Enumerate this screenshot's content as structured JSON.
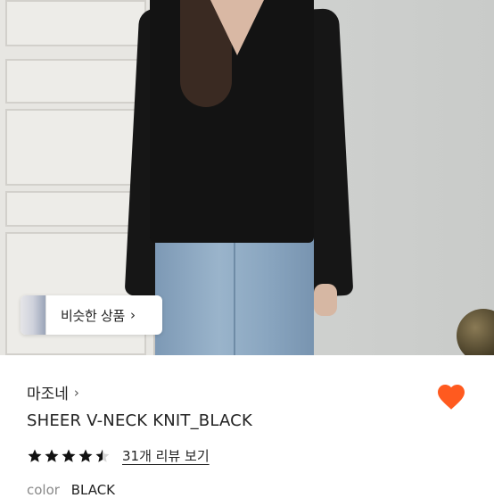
{
  "hero": {
    "similar_products_label": "비슷한 상품",
    "similar_products_arrow": "›"
  },
  "product": {
    "brand": "마조네",
    "brand_arrow": "›",
    "title": "SHEER V-NECK KNIT_BLACK",
    "rating": 4.5,
    "review_link": "31개 리뷰 보기",
    "option_label": "color",
    "option_value": "BLACK",
    "favorited": true
  },
  "colors": {
    "heart": "#ff5a1f",
    "star": "#111111"
  }
}
